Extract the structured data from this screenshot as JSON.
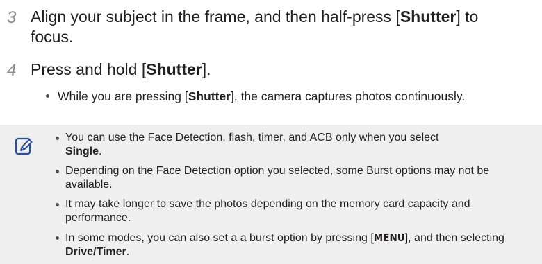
{
  "steps": [
    {
      "number": "3",
      "text_before": "Align your subject in the frame, and then half-press [",
      "key": "Shutter",
      "text_after": "] to focus."
    },
    {
      "number": "4",
      "text_before": "Press and hold [",
      "key": "Shutter",
      "text_after": "].",
      "bullet": {
        "text_before": "While you are pressing [",
        "key": "Shutter",
        "text_after": "], the camera captures photos continuously."
      }
    }
  ],
  "note": {
    "icon": "note-pencil-icon",
    "items": [
      {
        "text": "You can use the Face Detection, flash, timer, and ACB only when you select",
        "bold": "Single",
        "after": "."
      },
      {
        "text": "Depending on the Face Detection option you selected, some Burst options may not be available."
      },
      {
        "text": "It may take longer to save the photos depending on the memory card capacity and performance."
      },
      {
        "text_before": "In some modes, you can also set a a burst option by pressing [",
        "key": "MENU",
        "text_middle": "], and then selecting ",
        "bold": "Drive/Timer",
        "after": "."
      }
    ]
  },
  "colors": {
    "step_number": "#8c8c8c",
    "note_background": "#efefef",
    "icon_stroke": "#2b4e9b"
  }
}
